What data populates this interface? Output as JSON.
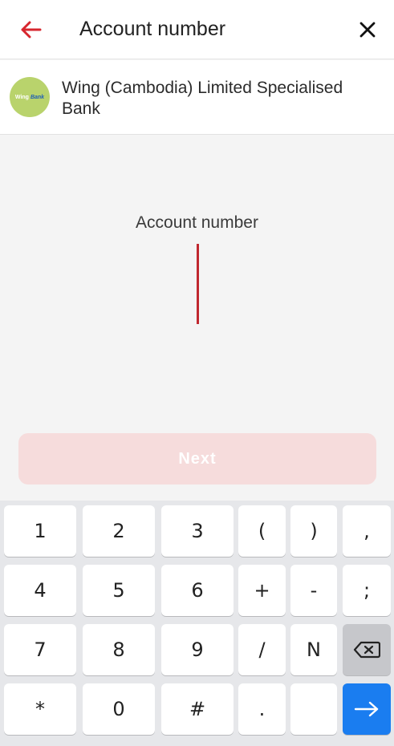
{
  "header": {
    "title": "Account number",
    "back_icon": "arrow-left-icon",
    "close_icon": "close-icon",
    "accent_color": "#d7262e"
  },
  "bank": {
    "name": "Wing (Cambodia) Limited Specialised Bank",
    "logo_text_wing": "Wing",
    "logo_text_bank": "Bank"
  },
  "field": {
    "label": "Account number",
    "value": ""
  },
  "next_button": {
    "label": "Next",
    "enabled": false
  },
  "keyboard": {
    "rows": [
      [
        "1",
        "2",
        "3",
        "(",
        ")",
        ","
      ],
      [
        "4",
        "5",
        "6",
        "+",
        "-",
        ";"
      ],
      [
        "7",
        "8",
        "9",
        "/",
        "N",
        "backspace-icon"
      ],
      [
        "*",
        "0",
        "#",
        ".",
        "",
        "enter-arrow-icon"
      ]
    ]
  }
}
